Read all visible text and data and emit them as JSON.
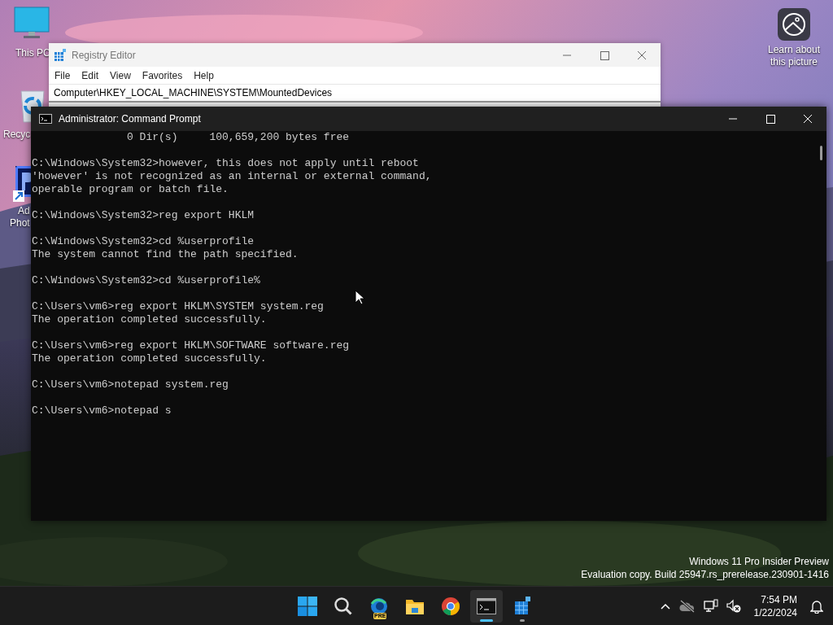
{
  "desktop": {
    "icons": [
      {
        "kind": "monitor",
        "label": "This PC"
      },
      {
        "kind": "recycle",
        "label": "Recyc"
      },
      {
        "kind": "photoshop",
        "label": "Ad",
        "label_2": "Phot"
      }
    ],
    "spotlight": {
      "label": "Learn about this picture"
    },
    "watermark": {
      "line_1": "Windows 11 Pro Insider Preview",
      "line_2": "Evaluation copy. Build 25947.rs_prerelease.230901-1416"
    }
  },
  "registry_editor": {
    "title": "Registry Editor",
    "menu": [
      "File",
      "Edit",
      "View",
      "Favorites",
      "Help"
    ],
    "address": "Computer\\HKEY_LOCAL_MACHINE\\SYSTEM\\MountedDevices"
  },
  "command_prompt": {
    "title": "Administrator: Command Prompt",
    "blocks": [
      [
        "               0 Dir(s)     100,659,200 bytes free"
      ],
      [
        "C:\\Windows\\System32>however, this does not apply until reboot",
        "'however' is not recognized as an internal or external command,",
        "operable program or batch file."
      ],
      [
        "C:\\Windows\\System32>reg export HKLM"
      ],
      [
        "C:\\Windows\\System32>cd %userprofile",
        "The system cannot find the path specified."
      ],
      [
        "C:\\Windows\\System32>cd %userprofile%"
      ],
      [
        "C:\\Users\\vm6>reg export HKLM\\SYSTEM system.reg",
        "The operation completed successfully."
      ],
      [
        "C:\\Users\\vm6>reg export HKLM\\SOFTWARE software.reg",
        "The operation completed successfully."
      ],
      [
        "C:\\Users\\vm6>notepad system.reg"
      ],
      [
        "C:\\Users\\vm6>notepad s"
      ]
    ]
  },
  "taskbar": {
    "apps": [
      {
        "kind": "start",
        "running": false,
        "selected": false
      },
      {
        "kind": "search",
        "running": false,
        "selected": false
      },
      {
        "kind": "edge",
        "running": false,
        "selected": false
      },
      {
        "kind": "explorer",
        "running": false,
        "selected": false
      },
      {
        "kind": "chrome",
        "running": false,
        "selected": false
      },
      {
        "kind": "terminal",
        "running": true,
        "selected": true
      },
      {
        "kind": "regedit",
        "running": true,
        "selected": false
      }
    ],
    "edge_badge": "PRE",
    "time": "7:54 PM",
    "date": "1/22/2024"
  }
}
